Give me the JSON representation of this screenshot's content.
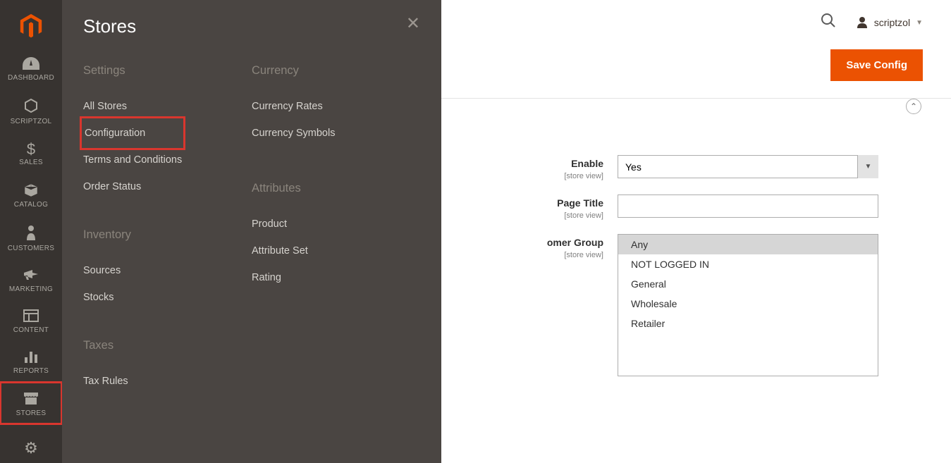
{
  "sidebar": {
    "items": [
      {
        "label": "DASHBOARD"
      },
      {
        "label": "SCRIPTZOL"
      },
      {
        "label": "SALES"
      },
      {
        "label": "CATALOG"
      },
      {
        "label": "CUSTOMERS"
      },
      {
        "label": "MARKETING"
      },
      {
        "label": "CONTENT"
      },
      {
        "label": "REPORTS"
      },
      {
        "label": "STORES"
      }
    ]
  },
  "flyout": {
    "title": "Stores",
    "sections": {
      "settings": {
        "title": "Settings",
        "items": [
          "All Stores",
          "Configuration",
          "Terms and Conditions",
          "Order Status"
        ]
      },
      "inventory": {
        "title": "Inventory",
        "items": [
          "Sources",
          "Stocks"
        ]
      },
      "taxes": {
        "title": "Taxes",
        "items": [
          "Tax Rules"
        ]
      },
      "currency": {
        "title": "Currency",
        "items": [
          "Currency Rates",
          "Currency Symbols"
        ]
      },
      "attributes": {
        "title": "Attributes",
        "items": [
          "Product",
          "Attribute Set",
          "Rating"
        ]
      }
    }
  },
  "topbar": {
    "user": "scriptzol",
    "save_button": "Save Config"
  },
  "form": {
    "enable": {
      "label": "Enable",
      "scope": "[store view]",
      "value": "Yes"
    },
    "page_title": {
      "label": "Page Title",
      "scope": "[store view]",
      "value": ""
    },
    "customer_group": {
      "label": "omer Group",
      "scope": "[store view]",
      "options": [
        "Any",
        "NOT LOGGED IN",
        "General",
        "Wholesale",
        "Retailer"
      ],
      "selected": "Any"
    }
  }
}
